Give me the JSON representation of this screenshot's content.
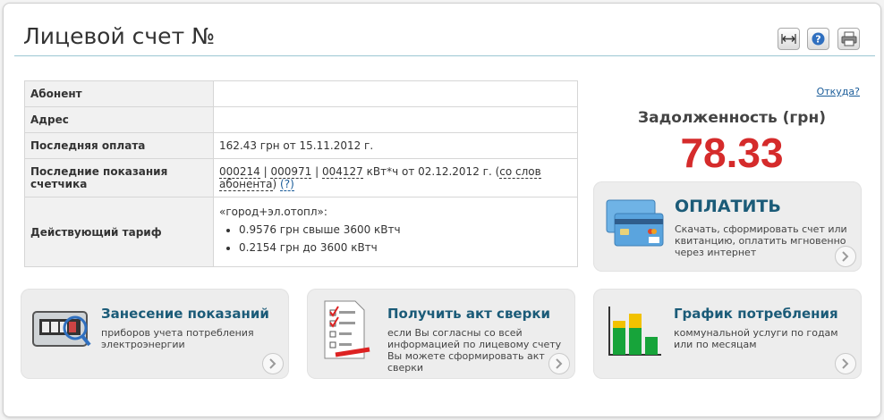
{
  "header": {
    "title": "Лицевой счет №",
    "buttons": [
      "expand-icon",
      "help-icon",
      "print-icon"
    ]
  },
  "account_table": {
    "rows": [
      {
        "label": "Абонент",
        "value": ""
      },
      {
        "label": "Адрес",
        "value": ""
      },
      {
        "label": "Последняя оплата",
        "value": "162.43 грн от 15.11.2012 г."
      },
      {
        "label": "Последние показания счетчика"
      },
      {
        "label": "Действующий тариф"
      }
    ],
    "readings": {
      "r1": "000214",
      "sep1": " | ",
      "r2": "000971",
      "sep2": " | ",
      "r3": "004127",
      "suffix": " кВт*ч от 02.12.2012 г. (",
      "source": "со слов абонента",
      "close": ")",
      "help": "(?)"
    },
    "tariff": {
      "title": "«город+эл.отопл»:",
      "items": [
        "0.9576 грн свыше 3600 кВтч",
        "0.2154 грн до 3600 кВтч"
      ]
    }
  },
  "debt": {
    "source_link": "Откуда?",
    "label": "Задолженность (грн)",
    "amount": "78.33"
  },
  "cards": {
    "pay": {
      "title": "ОПЛАТИТЬ",
      "text": "Скачать, сформировать счет или квитанцию, оплатить мгновенно через интернет"
    },
    "readings": {
      "title": "Занесение показаний",
      "text": "приборов учета потребления электроэнергии"
    },
    "act": {
      "title": "Получить акт сверки",
      "text": "если Вы согласны со всей информацией по лицевому счету Вы можете сформировать акт сверки"
    },
    "chart": {
      "title": "График потребления",
      "text": "коммунальной услуги по годам или по месяцам"
    }
  }
}
